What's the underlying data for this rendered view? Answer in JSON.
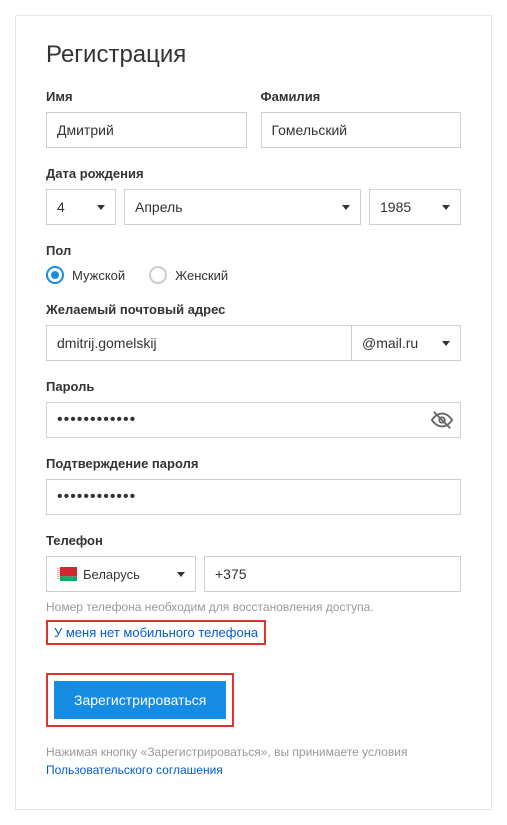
{
  "title": "Регистрация",
  "name": {
    "first_label": "Имя",
    "first_value": "Дмитрий",
    "last_label": "Фамилия",
    "last_value": "Гомельский"
  },
  "birth": {
    "label": "Дата рождения",
    "day": "4",
    "month": "Апрель",
    "year": "1985"
  },
  "gender": {
    "label": "Пол",
    "male": "Мужской",
    "female": "Женский"
  },
  "email": {
    "label": "Желаемый почтовый адрес",
    "local": "dmitrij.gomelskij",
    "domain": "@mail.ru"
  },
  "password": {
    "label": "Пароль",
    "mask": "••••••••••••",
    "confirm_label": "Подтверждение пароля",
    "confirm_mask": "••••••••••••"
  },
  "phone": {
    "label": "Телефон",
    "country": "Беларусь",
    "code": "+375",
    "hint": "Номер телефона необходим для восстановления доступа.",
    "no_phone": "У меня нет мобильного телефона"
  },
  "submit": {
    "button": "Зарегистрироваться",
    "note_prefix": "Нажимая кнопку «Зарегистрироваться», вы принимаете условия ",
    "agreement_link": "Пользовательского соглашения"
  }
}
